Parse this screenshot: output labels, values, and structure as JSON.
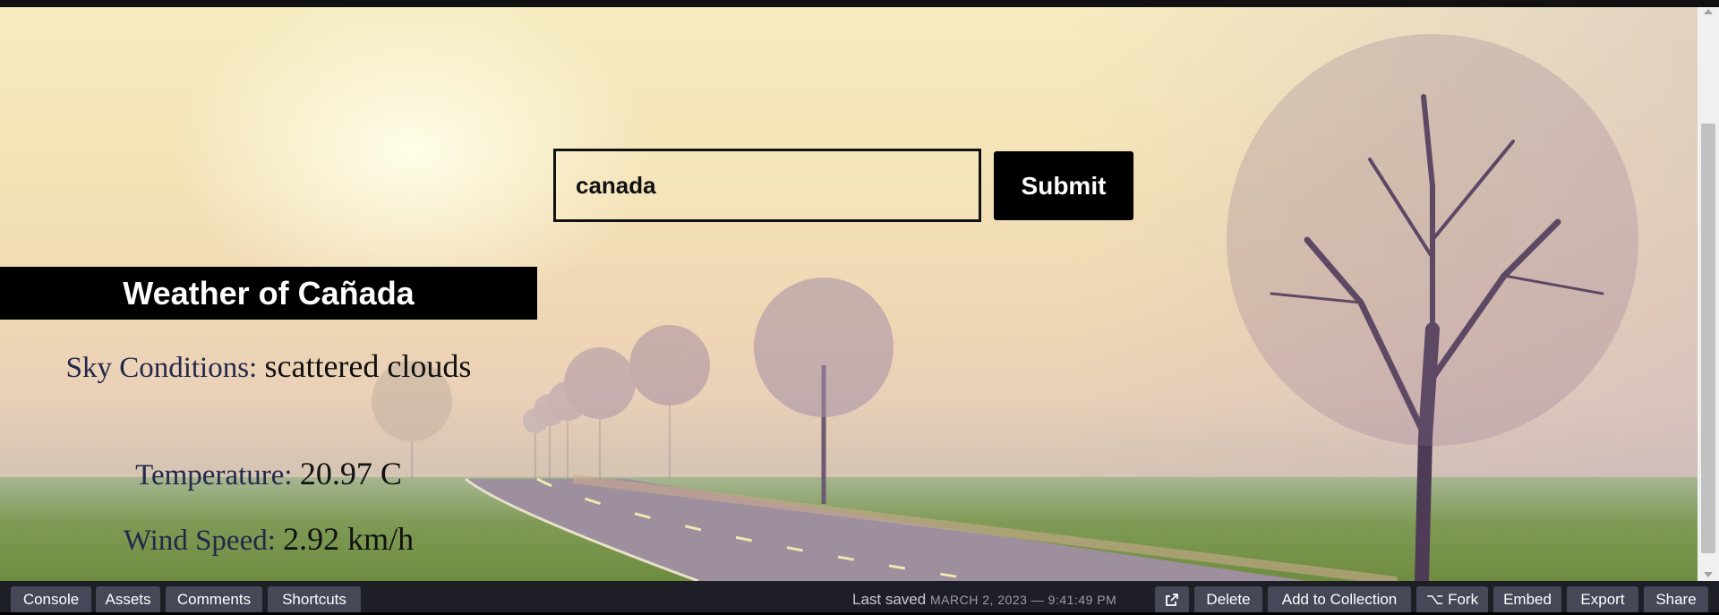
{
  "search": {
    "value": "canada",
    "submit_label": "Submit"
  },
  "weather": {
    "title": "Weather of Cañada",
    "sky_label": "Sky Conditions: ",
    "sky_value": "scattered clouds",
    "temp_label": "Temperature: ",
    "temp_value": "20.97 C",
    "wind_label": "Wind Speed: ",
    "wind_value": "2.92 km/h"
  },
  "bottom_bar": {
    "console": "Console",
    "assets": "Assets",
    "comments": "Comments",
    "shortcuts": "Shortcuts",
    "last_saved_label": "Last saved",
    "last_saved_date": "MARCH 2, 2023 — 9:41:49 PM",
    "delete": "Delete",
    "add_to_collection": "Add to Collection",
    "fork": "Fork",
    "embed": "Embed",
    "export": "Export",
    "share": "Share"
  },
  "icons": {
    "open_external": "external-link-icon",
    "fork": "fork-icon"
  }
}
